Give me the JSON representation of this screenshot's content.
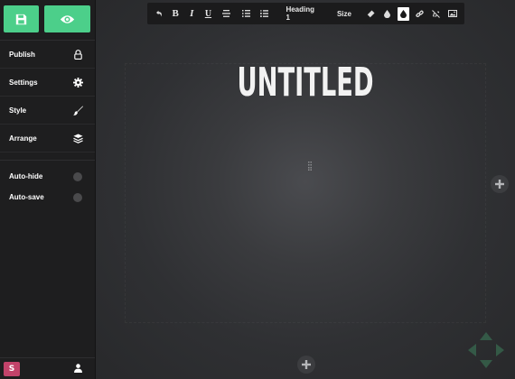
{
  "sidebar": {
    "top_buttons": [
      {
        "name": "save-button",
        "icon": "floppy-disk-icon"
      },
      {
        "name": "preview-button",
        "icon": "eye-icon"
      }
    ],
    "menu": [
      {
        "label": "Publish",
        "icon": "lock-icon"
      },
      {
        "label": "Settings",
        "icon": "gear-icon"
      },
      {
        "label": "Style",
        "icon": "paintbrush-icon"
      },
      {
        "label": "Arrange",
        "icon": "layers-icon"
      }
    ],
    "toggles": [
      {
        "label": "Auto-hide",
        "on": false
      },
      {
        "label": "Auto-save",
        "on": false
      }
    ],
    "bottom": {
      "logo_letter": "S",
      "user_icon": "user-icon"
    }
  },
  "toolbar": {
    "heading_label": "Heading 1",
    "size_label": "Size",
    "icons": [
      "undo-icon",
      "bold-icon",
      "italic-icon",
      "underline-icon",
      "align-center-icon",
      "bullet-list-icon",
      "numbered-list-icon",
      "eraser-icon",
      "text-color-icon",
      "background-color-icon",
      "link-icon",
      "unlink-icon",
      "image-icon"
    ],
    "bold_glyph": "B",
    "italic_glyph": "I",
    "underline_glyph": "U"
  },
  "canvas": {
    "title": "UNTITLED"
  },
  "colors": {
    "accent": "#4ccf8a",
    "sidebar_bg": "#1e1e1f",
    "canvas_bg": "#2c2d30",
    "toolbar_bg": "#1b1b1c",
    "logo_bg": "#c2436a"
  }
}
